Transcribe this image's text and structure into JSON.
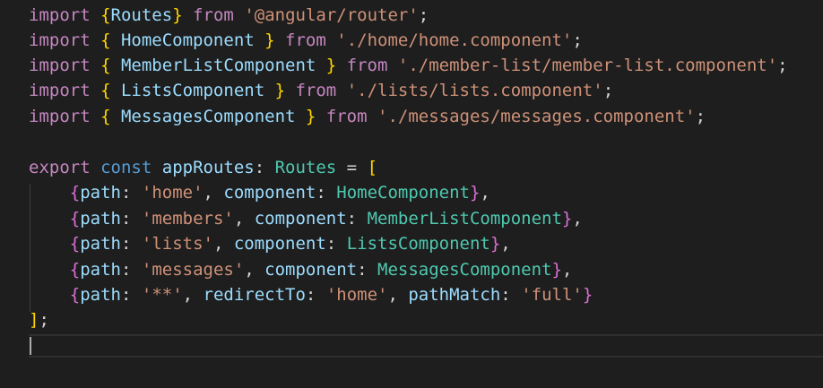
{
  "editor": {
    "colors": {
      "background": "#1e1e1e",
      "keyword": "#c586c0",
      "storage": "#569cd6",
      "brace_gold": "#ffd700",
      "brace_pink": "#da70d6",
      "brace_blue": "#179fff",
      "type": "#4ec9b0",
      "string": "#ce9178",
      "property": "#9cdcfe",
      "variable": "#9cdcfe",
      "punctuation": "#d4d4d4"
    },
    "lines": [
      [
        {
          "t": "import",
          "c": "keyword"
        },
        {
          "t": " ",
          "c": "punctuation"
        },
        {
          "t": "{",
          "c": "brace_gold"
        },
        {
          "t": "Routes",
          "c": "variable"
        },
        {
          "t": "}",
          "c": "brace_gold"
        },
        {
          "t": " ",
          "c": "punctuation"
        },
        {
          "t": "from",
          "c": "keyword"
        },
        {
          "t": " ",
          "c": "punctuation"
        },
        {
          "t": "'@angular/router'",
          "c": "string"
        },
        {
          "t": ";",
          "c": "punctuation"
        }
      ],
      [
        {
          "t": "import",
          "c": "keyword"
        },
        {
          "t": " ",
          "c": "punctuation"
        },
        {
          "t": "{",
          "c": "brace_gold"
        },
        {
          "t": " HomeComponent ",
          "c": "variable"
        },
        {
          "t": "}",
          "c": "brace_gold"
        },
        {
          "t": " ",
          "c": "punctuation"
        },
        {
          "t": "from",
          "c": "keyword"
        },
        {
          "t": " ",
          "c": "punctuation"
        },
        {
          "t": "'./home/home.component'",
          "c": "string"
        },
        {
          "t": ";",
          "c": "punctuation"
        }
      ],
      [
        {
          "t": "import",
          "c": "keyword"
        },
        {
          "t": " ",
          "c": "punctuation"
        },
        {
          "t": "{",
          "c": "brace_gold"
        },
        {
          "t": " MemberListComponent ",
          "c": "variable"
        },
        {
          "t": "}",
          "c": "brace_gold"
        },
        {
          "t": " ",
          "c": "punctuation"
        },
        {
          "t": "from",
          "c": "keyword"
        },
        {
          "t": " ",
          "c": "punctuation"
        },
        {
          "t": "'./member-list/member-list.component'",
          "c": "string"
        },
        {
          "t": ";",
          "c": "punctuation"
        }
      ],
      [
        {
          "t": "import",
          "c": "keyword"
        },
        {
          "t": " ",
          "c": "punctuation"
        },
        {
          "t": "{",
          "c": "brace_gold"
        },
        {
          "t": " ListsComponent ",
          "c": "variable"
        },
        {
          "t": "}",
          "c": "brace_gold"
        },
        {
          "t": " ",
          "c": "punctuation"
        },
        {
          "t": "from",
          "c": "keyword"
        },
        {
          "t": " ",
          "c": "punctuation"
        },
        {
          "t": "'./lists/lists.component'",
          "c": "string"
        },
        {
          "t": ";",
          "c": "punctuation"
        }
      ],
      [
        {
          "t": "import",
          "c": "keyword"
        },
        {
          "t": " ",
          "c": "punctuation"
        },
        {
          "t": "{",
          "c": "brace_gold"
        },
        {
          "t": " MessagesComponent ",
          "c": "variable"
        },
        {
          "t": "}",
          "c": "brace_gold"
        },
        {
          "t": " ",
          "c": "punctuation"
        },
        {
          "t": "from",
          "c": "keyword"
        },
        {
          "t": " ",
          "c": "punctuation"
        },
        {
          "t": "'./messages/messages.component'",
          "c": "string"
        },
        {
          "t": ";",
          "c": "punctuation"
        }
      ],
      [],
      [
        {
          "t": "export",
          "c": "keyword"
        },
        {
          "t": " ",
          "c": "punctuation"
        },
        {
          "t": "const",
          "c": "storage"
        },
        {
          "t": " ",
          "c": "punctuation"
        },
        {
          "t": "appRoutes",
          "c": "variable"
        },
        {
          "t": ": ",
          "c": "punctuation"
        },
        {
          "t": "Routes",
          "c": "type"
        },
        {
          "t": " = ",
          "c": "punctuation"
        },
        {
          "t": "[",
          "c": "brace_gold"
        }
      ],
      [
        {
          "t": "    ",
          "c": "punctuation"
        },
        {
          "t": "{",
          "c": "brace_pink"
        },
        {
          "t": "path",
          "c": "property"
        },
        {
          "t": ": ",
          "c": "punctuation"
        },
        {
          "t": "'home'",
          "c": "string"
        },
        {
          "t": ", ",
          "c": "punctuation"
        },
        {
          "t": "component",
          "c": "property"
        },
        {
          "t": ": ",
          "c": "punctuation"
        },
        {
          "t": "HomeComponent",
          "c": "type"
        },
        {
          "t": "}",
          "c": "brace_pink"
        },
        {
          "t": ",",
          "c": "punctuation"
        }
      ],
      [
        {
          "t": "    ",
          "c": "punctuation"
        },
        {
          "t": "{",
          "c": "brace_pink"
        },
        {
          "t": "path",
          "c": "property"
        },
        {
          "t": ": ",
          "c": "punctuation"
        },
        {
          "t": "'members'",
          "c": "string"
        },
        {
          "t": ", ",
          "c": "punctuation"
        },
        {
          "t": "component",
          "c": "property"
        },
        {
          "t": ": ",
          "c": "punctuation"
        },
        {
          "t": "MemberListComponent",
          "c": "type"
        },
        {
          "t": "}",
          "c": "brace_pink"
        },
        {
          "t": ",",
          "c": "punctuation"
        }
      ],
      [
        {
          "t": "    ",
          "c": "punctuation"
        },
        {
          "t": "{",
          "c": "brace_pink"
        },
        {
          "t": "path",
          "c": "property"
        },
        {
          "t": ": ",
          "c": "punctuation"
        },
        {
          "t": "'lists'",
          "c": "string"
        },
        {
          "t": ", ",
          "c": "punctuation"
        },
        {
          "t": "component",
          "c": "property"
        },
        {
          "t": ": ",
          "c": "punctuation"
        },
        {
          "t": "ListsComponent",
          "c": "type"
        },
        {
          "t": "}",
          "c": "brace_pink"
        },
        {
          "t": ",",
          "c": "punctuation"
        }
      ],
      [
        {
          "t": "    ",
          "c": "punctuation"
        },
        {
          "t": "{",
          "c": "brace_pink"
        },
        {
          "t": "path",
          "c": "property"
        },
        {
          "t": ": ",
          "c": "punctuation"
        },
        {
          "t": "'messages'",
          "c": "string"
        },
        {
          "t": ", ",
          "c": "punctuation"
        },
        {
          "t": "component",
          "c": "property"
        },
        {
          "t": ": ",
          "c": "punctuation"
        },
        {
          "t": "MessagesComponent",
          "c": "type"
        },
        {
          "t": "}",
          "c": "brace_pink"
        },
        {
          "t": ",",
          "c": "punctuation"
        }
      ],
      [
        {
          "t": "    ",
          "c": "punctuation"
        },
        {
          "t": "{",
          "c": "brace_pink"
        },
        {
          "t": "path",
          "c": "property"
        },
        {
          "t": ": ",
          "c": "punctuation"
        },
        {
          "t": "'**'",
          "c": "string"
        },
        {
          "t": ", ",
          "c": "punctuation"
        },
        {
          "t": "redirectTo",
          "c": "property"
        },
        {
          "t": ": ",
          "c": "punctuation"
        },
        {
          "t": "'home'",
          "c": "string"
        },
        {
          "t": ", ",
          "c": "punctuation"
        },
        {
          "t": "pathMatch",
          "c": "property"
        },
        {
          "t": ": ",
          "c": "punctuation"
        },
        {
          "t": "'full'",
          "c": "string"
        },
        {
          "t": "}",
          "c": "brace_pink"
        }
      ],
      [
        {
          "t": "]",
          "c": "brace_gold"
        },
        {
          "t": ";",
          "c": "punctuation"
        }
      ],
      []
    ]
  }
}
